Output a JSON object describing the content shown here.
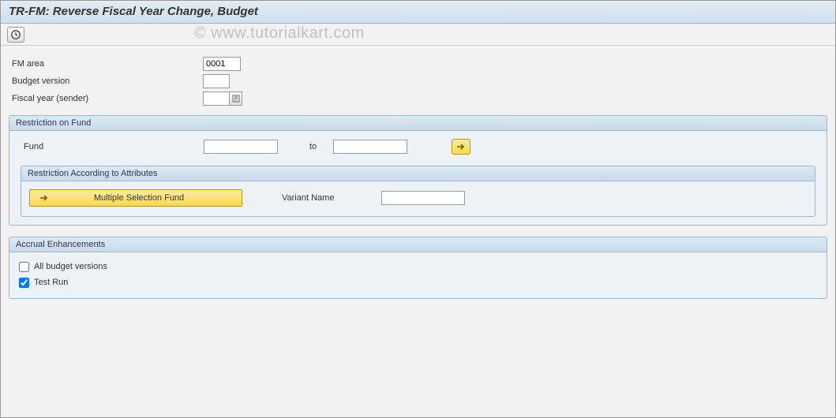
{
  "watermark": "© www.tutorialkart.com",
  "title": "TR-FM: Reverse Fiscal Year Change, Budget",
  "fields": {
    "fm_area_label": "FM area",
    "fm_area_value": "0001",
    "budget_version_label": "Budget version",
    "budget_version_value": "",
    "fiscal_year_label": "Fiscal year (sender)",
    "fiscal_year_value": ""
  },
  "group_fund": {
    "title": "Restriction on Fund",
    "fund_label": "Fund",
    "fund_from": "",
    "to_label": "to",
    "fund_to": ""
  },
  "group_attr": {
    "title": "Restriction According to Attributes",
    "msel_label": "Multiple Selection Fund",
    "variant_label": "Variant Name",
    "variant_value": ""
  },
  "group_accrual": {
    "title": "Accrual Enhancements",
    "all_budget_label": "All budget versions",
    "all_budget_checked": false,
    "test_run_label": "Test Run",
    "test_run_checked": true
  }
}
